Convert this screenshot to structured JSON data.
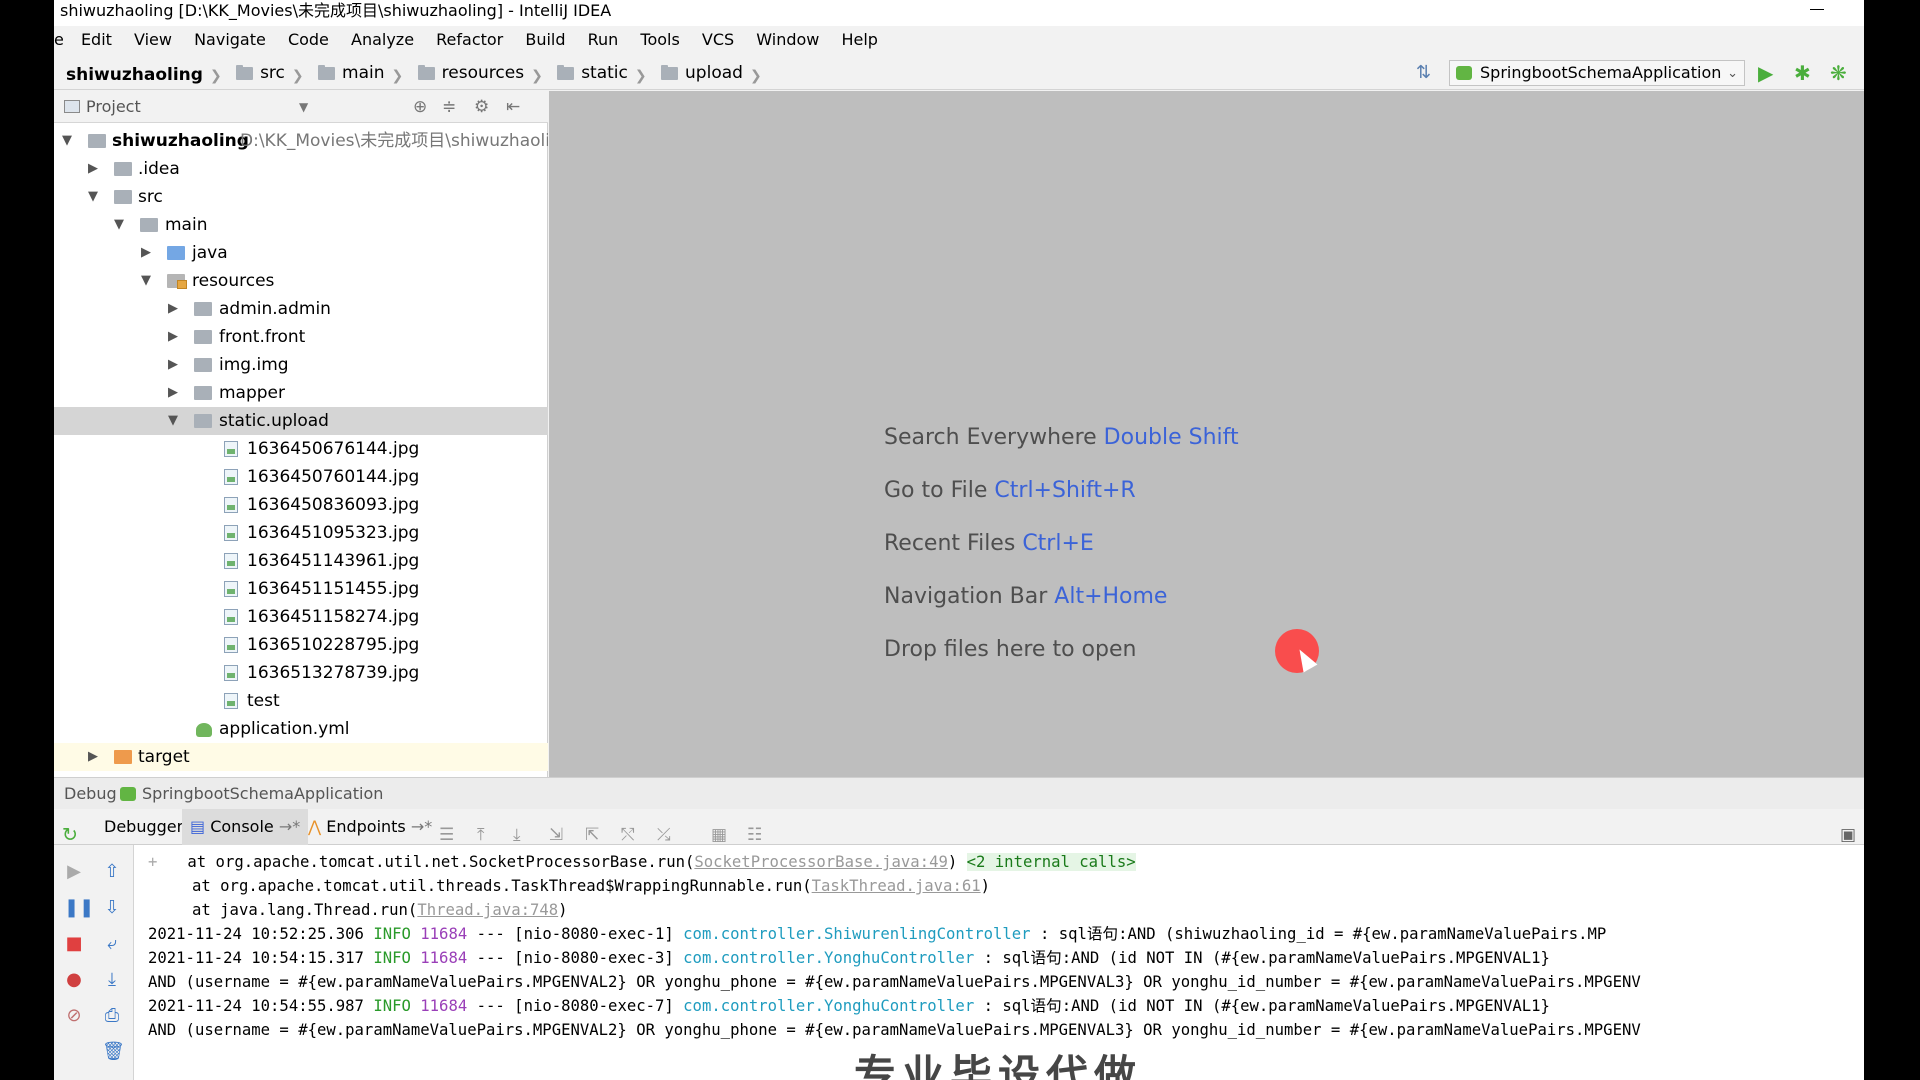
{
  "window_title": "shiwuzhaoling [D:\\KK_Movies\\未完成项目\\shiwuzhaoling] - IntelliJ IDEA",
  "menu": [
    "e",
    "Edit",
    "View",
    "Navigate",
    "Code",
    "Analyze",
    "Refactor",
    "Build",
    "Run",
    "Tools",
    "VCS",
    "Window",
    "Help"
  ],
  "breadcrumbs": [
    "shiwuzhaoling",
    "src",
    "main",
    "resources",
    "static",
    "upload"
  ],
  "run_config": "SpringbootSchemaApplication",
  "project_panel": {
    "title": "Project",
    "root_name": "shiwuzhaoling",
    "root_path": "D:\\KK_Movies\\未完成项目\\shiwuzhaoling",
    "items": [
      ".idea",
      "src",
      "main",
      "java",
      "resources",
      "admin.admin",
      "front.front",
      "img.img",
      "mapper",
      "static.upload",
      "1636450676144.jpg",
      "1636450760144.jpg",
      "1636450836093.jpg",
      "1636451095323.jpg",
      "1636451143961.jpg",
      "1636451151455.jpg",
      "1636451158274.jpg",
      "1636510228795.jpg",
      "1636513278739.jpg",
      "test",
      "application.yml",
      "target"
    ]
  },
  "editor_hints": [
    {
      "label": "Search Everywhere",
      "key": "Double Shift"
    },
    {
      "label": "Go to File",
      "key": "Ctrl+Shift+R"
    },
    {
      "label": "Recent Files",
      "key": "Ctrl+E"
    },
    {
      "label": "Navigation Bar",
      "key": "Alt+Home"
    },
    {
      "label": "Drop files here to open",
      "key": ""
    }
  ],
  "debug": {
    "label": "Debug",
    "config": "SpringbootSchemaApplication",
    "tabs": [
      "Debugger",
      "Console",
      "Endpoints"
    ]
  },
  "console": {
    "stack1_pre": "at org.apache.tomcat.util.net.SocketProcessorBase.run(",
    "stack1_link": "SocketProcessorBase.java:49",
    "stack1_post": ")",
    "stack1_tag": "<2 internal calls>",
    "stack2_pre": "at org.apache.tomcat.util.threads.TaskThread$WrappingRunnable.run(",
    "stack2_link": "TaskThread.java:61",
    "stack2_post": ")",
    "stack3_pre": "at java.lang.Thread.run(",
    "stack3_link": "Thread.java:748",
    "stack3_post": ")",
    "log1_time": "2021-11-24 10:52:25.306",
    "log1_level": "INFO",
    "log1_pid": "11684",
    "log1_thread": "--- [nio-8080-exec-1]",
    "log1_class": "com.controller.ShiwurenlingController",
    "log1_msg": ": sql语句:AND (shiwuzhaoling_id = #{ew.paramNameValuePairs.MP",
    "log2_time": "2021-11-24 10:54:15.317",
    "log2_level": "INFO",
    "log2_pid": "11684",
    "log2_thread": "--- [nio-8080-exec-3]",
    "log2_class": "com.controller.YonghuController",
    "log2_msg": ": sql语句:AND (id NOT IN (#{ew.paramNameValuePairs.MPGENVAL1}",
    "cont1": "AND (username = #{ew.paramNameValuePairs.MPGENVAL2} OR yonghu_phone = #{ew.paramNameValuePairs.MPGENVAL3} OR yonghu_id_number = #{ew.paramNameValuePairs.MPGENV",
    "log3_time": "2021-11-24 10:54:55.987",
    "log3_level": "INFO",
    "log3_pid": "11684",
    "log3_thread": "--- [nio-8080-exec-7]",
    "log3_class": "com.controller.YonghuController",
    "log3_msg": ": sql语句:AND (id NOT IN (#{ew.paramNameValuePairs.MPGENVAL1}",
    "cont2": "AND (username = #{ew.paramNameValuePairs.MPGENVAL2} OR yonghu_phone = #{ew.paramNameValuePairs.MPGENVAL3} OR yonghu_id_number = #{ew.paramNameValuePairs.MPGENV"
  },
  "watermark": "专业毕设代做"
}
